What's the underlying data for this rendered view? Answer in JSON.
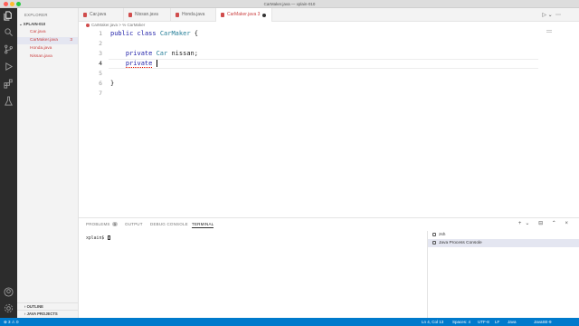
{
  "window": {
    "title": "CarMaker.java — xplain-010"
  },
  "sidebar": {
    "header": "EXPLORER",
    "folder": "XPLAIN-010",
    "files": [
      {
        "name": "Car.java",
        "badge": ""
      },
      {
        "name": "CarMaker.java",
        "badge": "3"
      },
      {
        "name": "Honda.java",
        "badge": ""
      },
      {
        "name": "Nissan.java",
        "badge": ""
      }
    ],
    "outline": "OUTLINE",
    "java_projects": "JAVA PROJECTS"
  },
  "tabs": [
    {
      "label": "Car.java",
      "badge": ""
    },
    {
      "label": "Nissan.java",
      "badge": ""
    },
    {
      "label": "Honda.java",
      "badge": ""
    },
    {
      "label": "CarMaker.java",
      "badge": "3"
    }
  ],
  "breadcrumb": {
    "file": "CarMaker.java",
    "sep": ">",
    "symbol": "CarMaker"
  },
  "editor": {
    "line_numbers": [
      "1",
      "2",
      "3",
      "4",
      "5",
      "6",
      "7"
    ],
    "l1": {
      "kw1": "public",
      "kw2": "class",
      "name": "CarMaker",
      "brace": "{"
    },
    "l3": {
      "kw": "private",
      "type": "Car",
      "rest": "nissan;"
    },
    "l4": {
      "kw": "private"
    },
    "l6": {
      "brace": "}"
    }
  },
  "panel": {
    "tabs": {
      "problems": "PROBLEMS",
      "problems_count": "3",
      "output": "OUTPUT",
      "debug": "DEBUG CONSOLE",
      "terminal": "TERMINAL"
    },
    "prompt": "xplain$",
    "terminals": [
      "zsh",
      "Java Process Console"
    ]
  },
  "status": {
    "left": "⊗ 3 ⚠ 0",
    "position": "Ln 4, Col 13",
    "spaces": "Spaces: 4",
    "encoding": "UTF-8",
    "eol": "LF",
    "language": "Java",
    "jdk": "JavaSE-9"
  }
}
